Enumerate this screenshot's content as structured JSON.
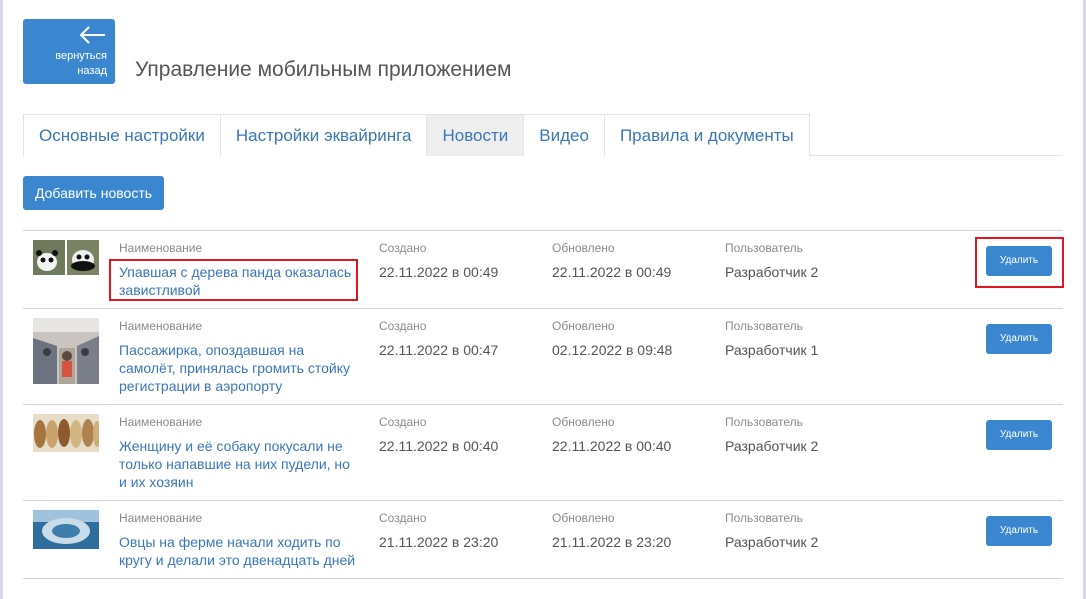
{
  "header": {
    "back_label": "вернуться назад",
    "title": "Управление мобильным приложением"
  },
  "tabs": [
    {
      "label": "Основные настройки",
      "active": false
    },
    {
      "label": "Настройки эквайринга",
      "active": false
    },
    {
      "label": "Новости",
      "active": true
    },
    {
      "label": "Видео",
      "active": false
    },
    {
      "label": "Правила и документы",
      "active": false
    }
  ],
  "add_button_label": "Добавить новость",
  "columns": {
    "name": "Наименование",
    "created": "Создано",
    "updated": "Обновлено",
    "user": "Пользователь"
  },
  "delete_label": "Удалить",
  "news": [
    {
      "title": "Упавшая с дерева панда оказалась завистливой",
      "created": "22.11.2022 в 00:49",
      "updated": "22.11.2022 в 00:49",
      "user": "Разработчик 2",
      "thumb": "panda-photo"
    },
    {
      "title": "Пассажирка, опоздавшая на самолёт, принялась громить стойку регистрации в аэропорту",
      "created": "22.11.2022 в 00:47",
      "updated": "02.12.2022 в 09:48",
      "user": "Разработчик 1",
      "thumb": "airplane-cabin-photo"
    },
    {
      "title": "Женщину и её собаку покусали не только напавшие на них пудели, но и их хозяин",
      "created": "22.11.2022 в 00:40",
      "updated": "22.11.2022 в 00:40",
      "user": "Разработчик 2",
      "thumb": "poodles-photo"
    },
    {
      "title": "Овцы на ферме начали ходить по кругу и делали это двенадцать дней",
      "created": "21.11.2022 в 23:20",
      "updated": "21.11.2022 в 23:20",
      "user": "Разработчик 2",
      "thumb": "sheep-circle-photo"
    }
  ],
  "colors": {
    "accent": "#3b87cf",
    "link": "#3b76b8",
    "highlight": "#e3161f",
    "active_tab_bg": "#eeeeee"
  }
}
